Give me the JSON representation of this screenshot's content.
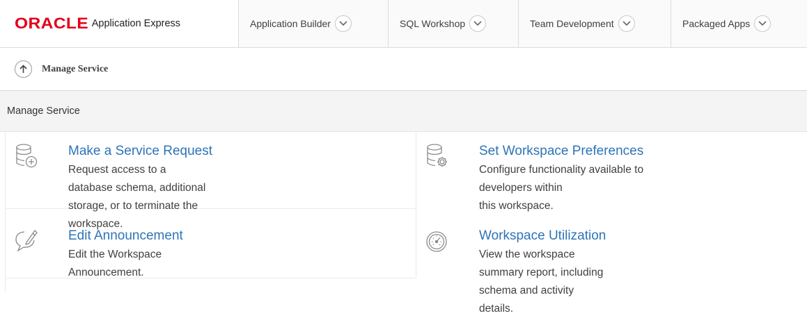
{
  "brand": {
    "logo_text": "ORACLE",
    "product": "Application Express"
  },
  "nav": {
    "tabs": [
      {
        "label": "Application Builder",
        "icon": "chevron-down-icon"
      },
      {
        "label": "SQL Workshop",
        "icon": "chevron-down-icon"
      },
      {
        "label": "Team Development",
        "icon": "chevron-down-icon"
      },
      {
        "label": "Packaged Apps",
        "icon": "chevron-down-icon"
      }
    ]
  },
  "breadcrumb": {
    "up_icon": "arrow-up-icon",
    "current": "Manage Service"
  },
  "region": {
    "title": "Manage Service"
  },
  "cards": [
    {
      "icon": "database-add-icon",
      "title": "Make a Service Request",
      "desc_lines": [
        "Request access to a database schema, additional",
        "storage, or to terminate the workspace."
      ]
    },
    {
      "icon": "database-settings-icon",
      "title": "Set Workspace Preferences",
      "desc_lines": [
        "Configure functionality available to developers within",
        "this workspace."
      ]
    },
    {
      "icon": "speech-bubble-edit-icon",
      "title": "Edit Announcement",
      "desc_lines": [
        "Edit the Workspace Announcement."
      ]
    },
    {
      "icon": "gauge-icon",
      "title": "Workspace Utilization",
      "desc_lines": [
        "View the workspace summary report, including",
        "schema and activity details."
      ]
    }
  ],
  "colors": {
    "oracle_red": "#e3001b",
    "link_blue": "#2d74b7",
    "text": "#404040"
  }
}
